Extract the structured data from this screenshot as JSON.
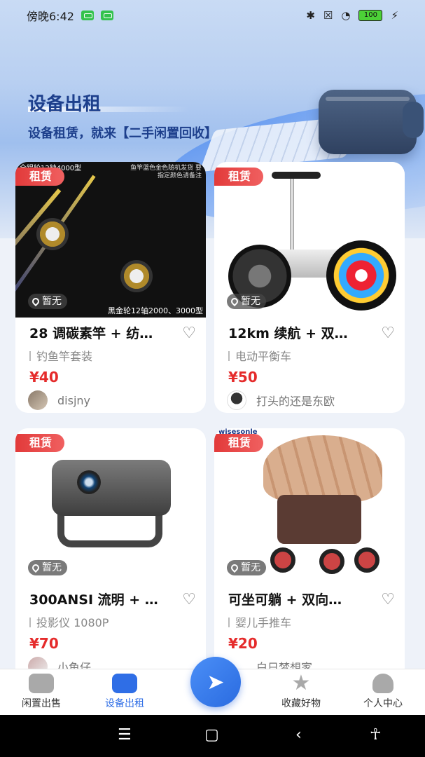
{
  "status": {
    "time": "傍晚6:42",
    "battery": "100"
  },
  "header": {
    "title": "设备出租",
    "subtitle": "设备租赁，就来【二手闲置回收】"
  },
  "cards": [
    {
      "tag": "租赁",
      "location": "暂无",
      "name": "28 调碳素竿 + 纺…",
      "category": "钓鱼竿套装",
      "price": "¥40",
      "seller": "disjny",
      "img_caption_top": "全铝轮12轴4000型",
      "img_caption_right": "鱼竿蓝色金色随机发货 要指定颜色请备注",
      "img_caption_bottom": "黑金轮12轴2000、3000型"
    },
    {
      "tag": "租赁",
      "location": "暂无",
      "name": "12km 续航 + 双…",
      "category": "电动平衡车",
      "price": "¥50",
      "seller": "打头的还是东欧"
    },
    {
      "tag": "租赁",
      "location": "暂无",
      "name": "300ANSI 流明 + …",
      "category": "投影仪 1080P",
      "price": "¥70",
      "seller": "小鱼仔"
    },
    {
      "tag": "租赁",
      "location": "暂无",
      "name": "可坐可躺 + 双向…",
      "category": "婴儿手推车",
      "price": "¥20",
      "seller": "白日梦想家",
      "img_caption_top": "wisesonle"
    }
  ],
  "tabs": [
    {
      "label": "闲置出售"
    },
    {
      "label": "设备出租"
    },
    {
      "label": "收藏好物"
    },
    {
      "label": "个人中心"
    }
  ],
  "icons": {
    "fab": "send-icon"
  },
  "colors": {
    "accent": "#2f6ee6",
    "price": "#e52b2b",
    "tag": "#e23a3a"
  }
}
